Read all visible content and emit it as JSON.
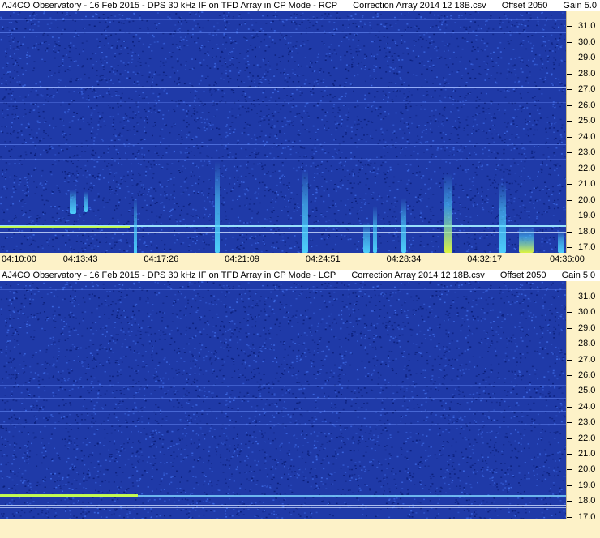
{
  "panels": [
    {
      "title_parts": [
        "AJ4CO Observatory - 16 Feb 2015 - DPS 30 kHz IF on TFD Array in CP Mode - RCP",
        "Correction Array 2014 12 18B.csv",
        "Offset 2050",
        "Gain 5.0"
      ],
      "y_ticks": [
        "31.0",
        "30.0",
        "29.0",
        "28.0",
        "27.0",
        "26.0",
        "25.0",
        "24.0",
        "23.0",
        "22.0",
        "21.0",
        "20.0",
        "19.0",
        "18.0",
        "17.0"
      ],
      "x_ticks": [
        "04:10:00",
        "04:13:43",
        "04:17:26",
        "04:21:09",
        "04:24:51",
        "04:28:34",
        "04:32:17",
        "04:36:00"
      ]
    },
    {
      "title_parts": [
        "AJ4CO Observatory - 16 Feb 2015 - DPS 30 kHz IF on TFD Array in CP Mode - LCP",
        "Correction Array 2014 12 18B.csv",
        "Offset 2050",
        "Gain 5.0"
      ],
      "y_ticks": [
        "31.0",
        "30.0",
        "29.0",
        "28.0",
        "27.0",
        "26.0",
        "25.0",
        "24.0",
        "23.0",
        "22.0",
        "21.0",
        "20.0",
        "19.0",
        "18.0",
        "17.0"
      ]
    }
  ],
  "colors": {
    "background_blue": "#1f3aa8",
    "noise_dark": "#0b1f7a",
    "noise_light": "#3b66e0",
    "burst_cyan": "#4fd6ff",
    "burst_yellow": "#e8ff3a",
    "axis_bg": "#fdf2c8"
  }
}
